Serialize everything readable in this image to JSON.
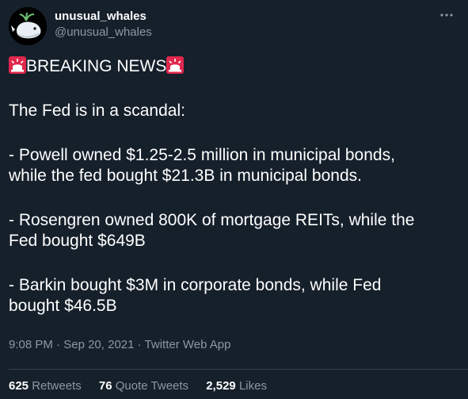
{
  "user": {
    "display_name": "unusual_whales",
    "handle": "@unusual_whales",
    "avatar_icon": "whale-icon"
  },
  "menu": {
    "icon": "more-icon"
  },
  "tweet": {
    "breaking": "BREAKING NEWS",
    "siren_icon": "police-siren-icon",
    "line1": "The Fed is in a scandal:",
    "line2": "- Powell owned $1.25-2.5 million in municipal bonds,",
    "line3": "while the fed bought $21.3B in municipal bonds.",
    "line4": "- Rosengren owned 800K of mortgage REITs, while the",
    "line5": "Fed bought $649B",
    "line6": "- Barkin bought $3M in corporate bonds, while Fed",
    "line7": "bought $46.5B"
  },
  "meta": {
    "time": "9:08 PM",
    "sep1": " · ",
    "date": "Sep 20, 2021",
    "sep2": " · ",
    "source": "Twitter Web App"
  },
  "stats": {
    "retweets_count": "625",
    "retweets_label": "Retweets",
    "quotes_count": "76",
    "quotes_label": "Quote Tweets",
    "likes_count": "2,529",
    "likes_label": "Likes"
  },
  "colors": {
    "background": "#15202b",
    "secondary_text": "#8b98a5",
    "divider": "#38444d",
    "siren_red": "#e0284d"
  }
}
